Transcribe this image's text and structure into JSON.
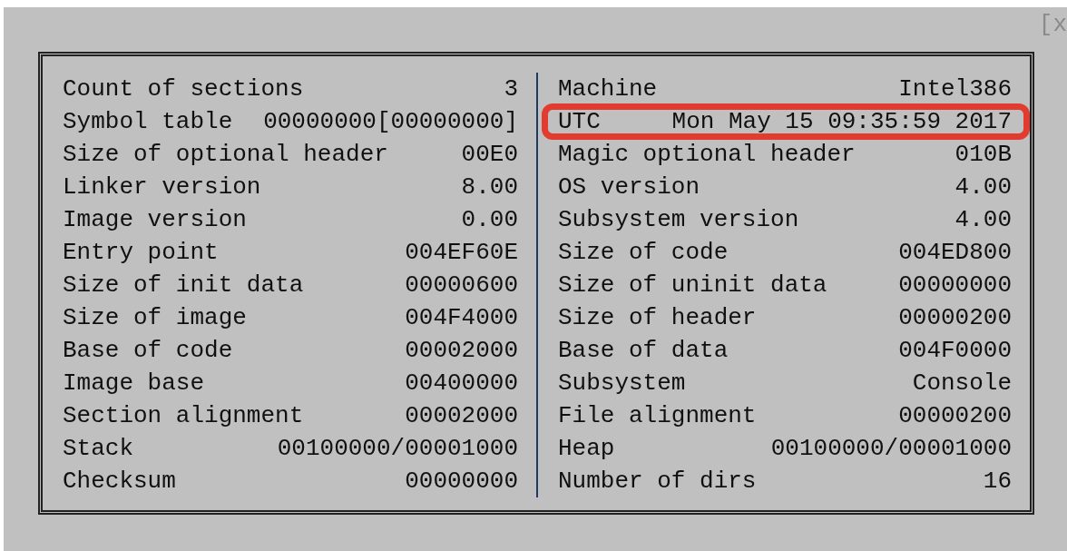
{
  "close_mark": "[x",
  "left": [
    {
      "label": "Count of sections",
      "value": "3"
    },
    {
      "label": "Symbol table",
      "value": "00000000[00000000]"
    },
    {
      "label": "Size of optional header",
      "value": "00E0"
    },
    {
      "label": "Linker version",
      "value": "8.00"
    },
    {
      "label": "Image version",
      "value": "0.00"
    },
    {
      "label": "Entry point",
      "value": "004EF60E"
    },
    {
      "label": "Size of init data",
      "value": "00000600"
    },
    {
      "label": "Size of image",
      "value": "004F4000"
    },
    {
      "label": "Base of code",
      "value": "00002000"
    },
    {
      "label": "Image base",
      "value": "00400000"
    },
    {
      "label": "Section alignment",
      "value": "00002000"
    },
    {
      "label": "Stack",
      "value": "00100000/00001000"
    },
    {
      "label": "Checksum",
      "value": "00000000"
    }
  ],
  "right": [
    {
      "label": "Machine",
      "value": "Intel386",
      "highlighted": false
    },
    {
      "label": "UTC",
      "value": "Mon May 15 09:35:59 2017",
      "highlighted": true
    },
    {
      "label": "Magic optional header",
      "value": "010B",
      "highlighted": false
    },
    {
      "label": "OS version",
      "value": "4.00",
      "highlighted": false
    },
    {
      "label": "Subsystem version",
      "value": "4.00",
      "highlighted": false
    },
    {
      "label": "Size of code",
      "value": "004ED800",
      "highlighted": false
    },
    {
      "label": "Size of uninit data",
      "value": "00000000",
      "highlighted": false
    },
    {
      "label": "Size of header",
      "value": "00000200",
      "highlighted": false
    },
    {
      "label": "Base of data",
      "value": "004F0000",
      "highlighted": false
    },
    {
      "label": "Subsystem",
      "value": "Console",
      "highlighted": false
    },
    {
      "label": "File alignment",
      "value": "00000200",
      "highlighted": false
    },
    {
      "label": "Heap",
      "value": "00100000/00001000",
      "highlighted": false
    },
    {
      "label": "Number of dirs",
      "value": "16",
      "highlighted": false
    }
  ]
}
